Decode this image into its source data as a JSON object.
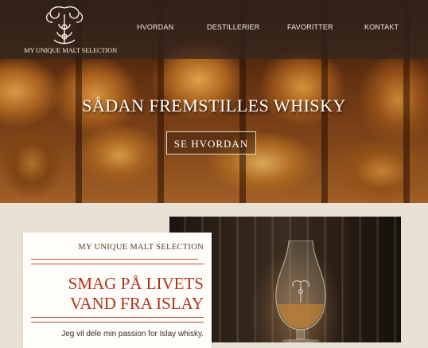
{
  "brand": {
    "name": "MY UNIQUE MALT SELECTION"
  },
  "nav": {
    "items": [
      {
        "label": "HVORDAN"
      },
      {
        "label": "DESTILLERIER"
      },
      {
        "label": "FAVORITTER"
      },
      {
        "label": "KONTAKT"
      }
    ]
  },
  "hero": {
    "title": "SÅDAN FREMSTILLES WHISKY",
    "button_label": "SE HVORDAN"
  },
  "intro": {
    "kicker": "MY UNIQUE MALT SELECTION",
    "title_line1": "SMAG PÅ LIVETS",
    "title_line2": "VAND FRA ISLAY",
    "body": "Jeg vil dele min passion for Islay whisky."
  },
  "colors": {
    "accent": "#b3321a",
    "nav_bg": "#32261e",
    "page_bg": "#e8e2d6"
  }
}
